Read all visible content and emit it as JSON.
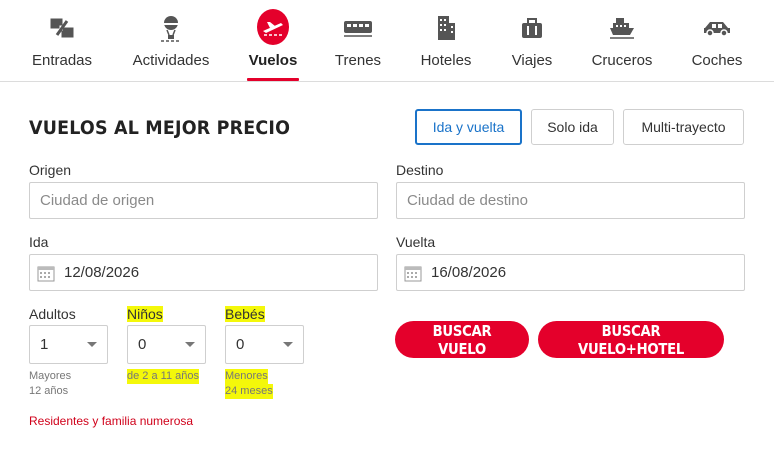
{
  "nav": {
    "items": [
      {
        "label": "Entradas",
        "icon": "ticket-icon"
      },
      {
        "label": "Actividades",
        "icon": "hot-air-balloon-icon"
      },
      {
        "label": "Vuelos",
        "icon": "airplane-icon",
        "active": true
      },
      {
        "label": "Trenes",
        "icon": "train-icon"
      },
      {
        "label": "Hoteles",
        "icon": "hotel-building-icon"
      },
      {
        "label": "Viajes",
        "icon": "suitcase-icon"
      },
      {
        "label": "Cruceros",
        "icon": "cruise-ship-icon"
      },
      {
        "label": "Coches",
        "icon": "car-icon"
      }
    ]
  },
  "search": {
    "title": "VUELOS AL MEJOR PRECIO",
    "trip_types": [
      "Ida y vuelta",
      "Solo ida",
      "Multi-trayecto"
    ],
    "selected_trip_type": "Ida y vuelta",
    "origin": {
      "label": "Origen",
      "placeholder": "Ciudad de origen",
      "value": ""
    },
    "destination": {
      "label": "Destino",
      "placeholder": "Ciudad de destino",
      "value": ""
    },
    "departure": {
      "label": "Ida",
      "value": "12/08/2026"
    },
    "return": {
      "label": "Vuelta",
      "value": "16/08/2026"
    },
    "adults": {
      "label": "Adultos",
      "value": "1",
      "note_line1": "Mayores",
      "note_line2": "12 años"
    },
    "children": {
      "label": "Niños",
      "value": "0",
      "note_line1": "de 2 a 11 años"
    },
    "infants": {
      "label": "Bebés",
      "value": "0",
      "note_line1": "Menores",
      "note_line2": "24 meses"
    },
    "search_flight_button": "BUSCAR VUELO",
    "search_flight_hotel_button": "BUSCAR VUELO+HOTEL",
    "residents_link": "Residentes y familia numerosa"
  },
  "colors": {
    "accent": "#e4002b",
    "selected_border": "#1a73c9",
    "highlight": "#f4f80a",
    "link": "#d0021b"
  }
}
